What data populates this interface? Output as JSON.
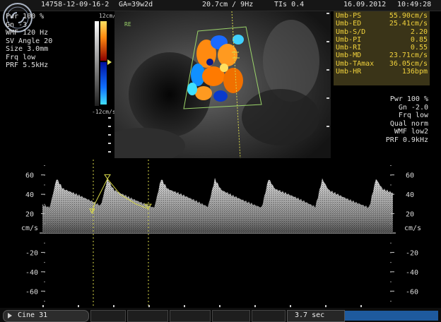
{
  "header": {
    "study_id": "14758-12-09-16-2",
    "gestational_age": "GA=39w2d",
    "depth_freq": "20.7cm / 9Hz",
    "tis": "TIs 0.4",
    "date": "16.09.2012",
    "time": "10:49:28"
  },
  "left_params": [
    "Pwr 100 %",
    "Gn -3",
    "WMF 120 Hz",
    "SV Angle 20",
    "Size 3.0mm",
    "Frq low",
    "PRF 5.5kHz"
  ],
  "color_scale": {
    "top_label": "12cm/s",
    "bottom_label": "-12cm/s"
  },
  "image_marker": "RE",
  "measurements": [
    {
      "label": "Umb-PS",
      "value": "55.90cm/s"
    },
    {
      "label": "Umb-ED",
      "value": "25.41cm/s"
    },
    {
      "label": "Umb-S/D",
      "value": "2.20"
    },
    {
      "label": "Umb-PI",
      "value": "0.85"
    },
    {
      "label": "Umb-RI",
      "value": "0.55"
    },
    {
      "label": "Umb-MD",
      "value": "23.71cm/s"
    },
    {
      "label": "Umb-TAmax",
      "value": "36.05cm/s"
    },
    {
      "label": "Umb-HR",
      "value": "136bpm"
    }
  ],
  "right_params": [
    "Pwr 100 %",
    "Gn -2.0",
    "Frq low",
    "Qual norm",
    "WMF low2",
    "PRF 0.9kHz"
  ],
  "spectral": {
    "unit": "cm/s",
    "ticks": [
      "60",
      "40",
      "20",
      "-20",
      "-40",
      "-60"
    ],
    "tick_values": [
      60,
      40,
      20,
      -20,
      -40,
      -60
    ],
    "range": [
      -70,
      70
    ]
  },
  "bottom": {
    "cine_label": "Cine 31",
    "time_label": "3.7 sec",
    "progress": 1.0
  },
  "colors": {
    "measurement_text": "#f1d23c",
    "measurement_bg": "#3a3418",
    "trace_line": "#d8d84a",
    "progress_bar": "#1e5a9e"
  }
}
